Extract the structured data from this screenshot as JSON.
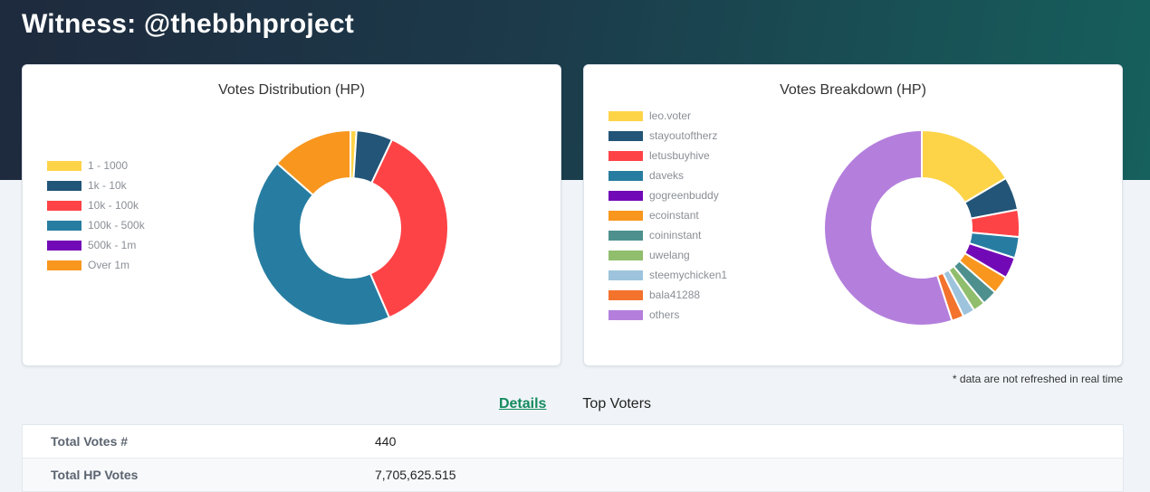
{
  "header": {
    "title": "Witness: @thebbhproject"
  },
  "distribution": {
    "title": "Votes Distribution (HP)",
    "legend": [
      {
        "label": "1 - 1000",
        "color": "#FDD448"
      },
      {
        "label": "1k - 10k",
        "color": "#225577"
      },
      {
        "label": "10k - 100k",
        "color": "#FE4346"
      },
      {
        "label": "100k - 500k",
        "color": "#277DA1"
      },
      {
        "label": "500k - 1m",
        "color": "#7209B7"
      },
      {
        "label": "Over 1m",
        "color": "#F8961E"
      }
    ]
  },
  "breakdown": {
    "title": "Votes Breakdown (HP)",
    "legend": [
      {
        "label": "leo.voter",
        "color": "#FDD448"
      },
      {
        "label": "stayoutoftherz",
        "color": "#225577"
      },
      {
        "label": "letusbuyhive",
        "color": "#FE4346"
      },
      {
        "label": "daveks",
        "color": "#277DA1"
      },
      {
        "label": "gogreenbuddy",
        "color": "#7209B7"
      },
      {
        "label": "ecoinstant",
        "color": "#F8961E"
      },
      {
        "label": "coininstant",
        "color": "#4D908E"
      },
      {
        "label": "uwelang",
        "color": "#90BE6D"
      },
      {
        "label": "steemychicken1",
        "color": "#9DC4DC"
      },
      {
        "label": "bala41288",
        "color": "#F3722C"
      },
      {
        "label": "others",
        "color": "#B47FDC"
      }
    ]
  },
  "chart_data": [
    {
      "type": "pie",
      "title": "Votes Distribution (HP)",
      "categories": [
        "1 - 1000",
        "1k - 10k",
        "10k - 100k",
        "100k - 500k",
        "500k - 1m",
        "Over 1m"
      ],
      "values": [
        1.0,
        6.0,
        36.5,
        43.0,
        0,
        13.5
      ],
      "colors": [
        "#FDD448",
        "#225577",
        "#FE4346",
        "#277DA1",
        "#7209B7",
        "#F8961E"
      ]
    },
    {
      "type": "pie",
      "title": "Votes Breakdown (HP)",
      "categories": [
        "leo.voter",
        "stayoutoftherz",
        "letusbuyhive",
        "daveks",
        "gogreenbuddy",
        "ecoinstant",
        "coininstant",
        "uwelang",
        "steemychicken1",
        "bala41288",
        "others"
      ],
      "values": [
        16.5,
        5.5,
        4.5,
        3.5,
        3.5,
        3.0,
        2.5,
        2.0,
        2.0,
        2.0,
        55.0
      ],
      "colors": [
        "#FDD448",
        "#225577",
        "#FE4346",
        "#277DA1",
        "#7209B7",
        "#F8961E",
        "#4D908E",
        "#90BE6D",
        "#9DC4DC",
        "#F3722C",
        "#B47FDC"
      ]
    }
  ],
  "footnote": "* data are not refreshed in real time",
  "tabs": [
    {
      "label": "Details",
      "active": true
    },
    {
      "label": "Top Voters",
      "active": false
    }
  ],
  "details": [
    {
      "key": "Total Votes #",
      "value": "440"
    },
    {
      "key": "Total HP Votes",
      "value": "7,705,625.515"
    }
  ]
}
